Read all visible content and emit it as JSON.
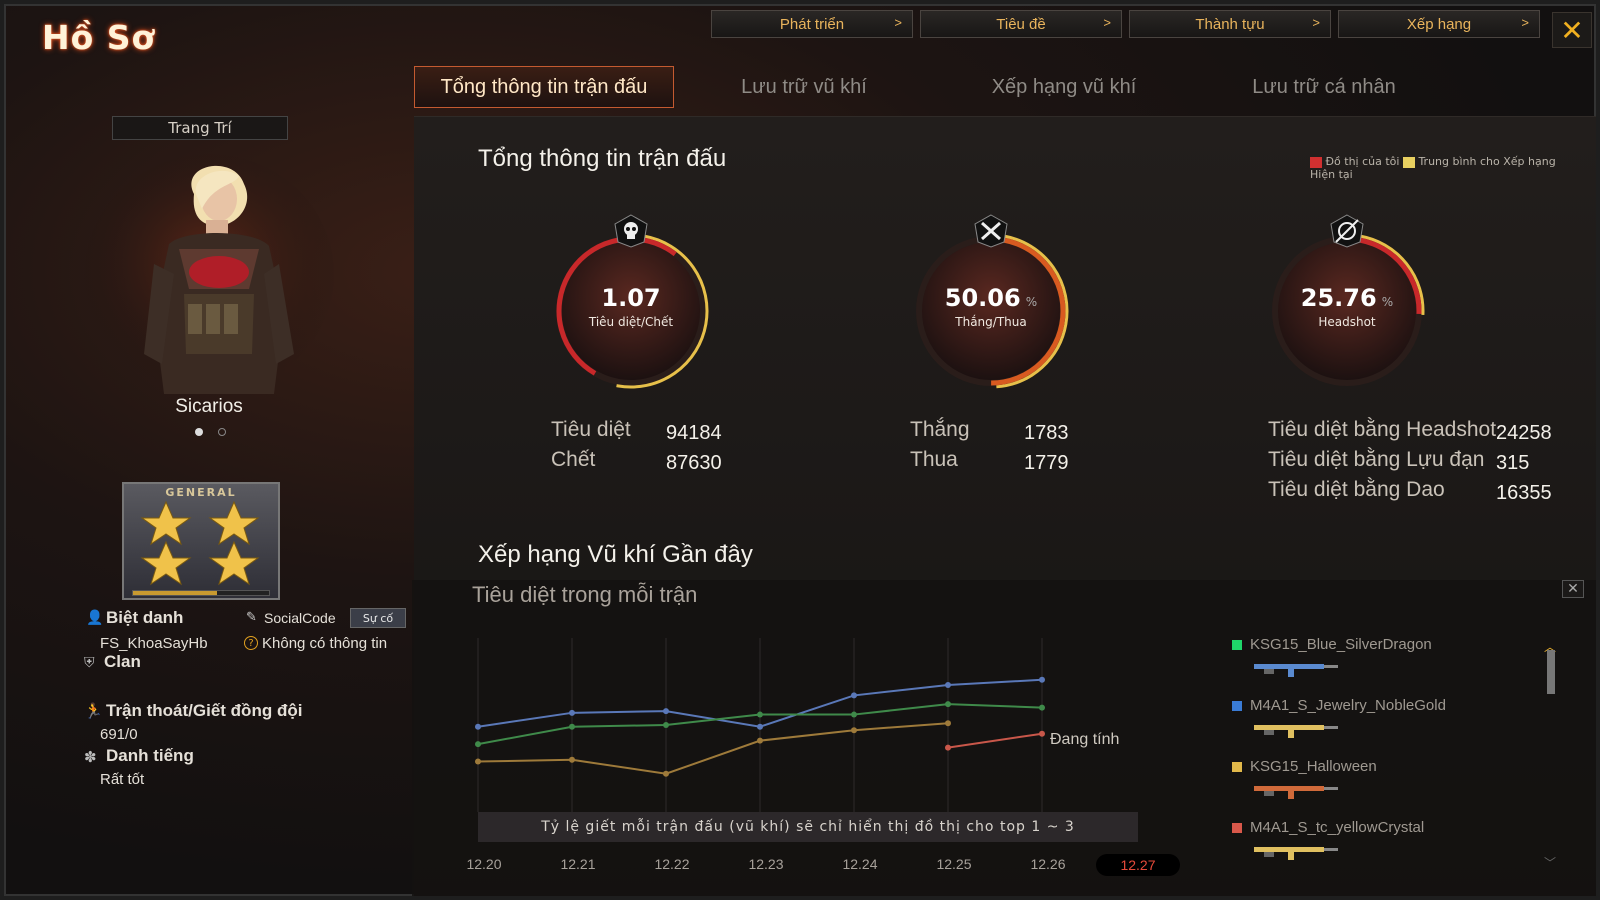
{
  "title": "Hồ Sơ",
  "top_nav": [
    {
      "label": "Phát triển",
      "chev": ">"
    },
    {
      "label": "Tiêu đề",
      "chev": ">"
    },
    {
      "label": "Thành tựu",
      "chev": ">"
    },
    {
      "label": "Xếp hạng",
      "chev": ">"
    }
  ],
  "close_icon": "✕",
  "tabs": [
    {
      "label": "Tổng thông tin trận đấu",
      "active": true
    },
    {
      "label": "Lưu trữ vũ khí",
      "active": false
    },
    {
      "label": "Xếp hạng vũ khí",
      "active": false
    },
    {
      "label": "Lưu trữ cá nhân",
      "active": false
    }
  ],
  "left": {
    "decor_button": "Trang Trí",
    "character_name": "Sicarios",
    "rank_label": "GENERAL",
    "nickname_label": "Biệt danh",
    "nickname_value": "FS_KhoaSayHb",
    "socialcode_label": "SocialCode",
    "socialcode_button": "Sự cố",
    "socialcode_value": "Không có thông tin",
    "clan_label": "Clan",
    "escape_label": "Trận thoát/Giết đồng đội",
    "escape_value": "691/0",
    "reputation_label": "Danh tiếng",
    "reputation_value": "Rất tốt"
  },
  "main": {
    "section_title": "Tổng thông tin trận đấu",
    "legend_mine": "Đồ thị của tôi",
    "legend_avg": "Trung bình cho Xếp hạng Hiện tại",
    "kd": {
      "value": "1.07",
      "unit": "",
      "label": "Tiêu diệt/Chết",
      "fraction": 0.52
    },
    "wl": {
      "value": "50.06",
      "unit": "%",
      "label": "Thắng/Thua",
      "fraction": 0.5
    },
    "hs": {
      "value": "25.76",
      "unit": "%",
      "label": "Headshot",
      "fraction": 0.26
    },
    "kd_rows": [
      {
        "label": "Tiêu diệt",
        "value": "94184"
      },
      {
        "label": "Chết",
        "value": "87630"
      }
    ],
    "wl_rows": [
      {
        "label": "Thắng",
        "value": "1783"
      },
      {
        "label": "Thua",
        "value": "1779"
      }
    ],
    "hs_rows": [
      {
        "label": "Tiêu diệt bằng Headshot",
        "value": "24258"
      },
      {
        "label": "Tiêu diệt bằng Lựu đạn",
        "value": "315"
      },
      {
        "label": "Tiêu diệt bằng Dao",
        "value": "16355"
      }
    ],
    "weapons_title": "Xếp hạng Vũ khí Gần đây",
    "chart_subtitle": "Tiêu diệt trong mỗi trận",
    "chart_note": "Tỷ lệ giết mỗi trận đấu (vũ khí) sẽ chỉ hiển thị đồ thị cho top 1 ~ 3",
    "computing": "Đang tính",
    "chart_close": "✕"
  },
  "chart_data": {
    "type": "line",
    "x": [
      "12.20",
      "12.21",
      "12.22",
      "12.23",
      "12.24",
      "12.25",
      "12.26",
      "12.27"
    ],
    "ylim": [
      0,
      10
    ],
    "series": [
      {
        "name": "KSG15_Blue_SilverDragon",
        "color": "#5a78b8",
        "values": [
          4.9,
          5.7,
          5.8,
          4.9,
          6.7,
          7.3,
          7.6,
          null
        ]
      },
      {
        "name": "M4A1_S_Jewelry_NobleGold",
        "color": "#3f8a4a",
        "values": [
          3.9,
          4.9,
          5.0,
          5.6,
          5.6,
          6.2,
          6.0,
          null
        ]
      },
      {
        "name": "KSG15_Halloween",
        "color": "#9e7a3a",
        "values": [
          2.9,
          3.0,
          2.2,
          4.1,
          4.7,
          5.1,
          null,
          null
        ]
      },
      {
        "name": "M4A1_S_tc_yellowCrystal",
        "color": "#c9574a",
        "values": [
          null,
          null,
          null,
          null,
          null,
          3.7,
          4.5,
          null
        ]
      }
    ],
    "legend": [
      {
        "name": "KSG15_Blue_SilverDragon",
        "color": "#1fd66a"
      },
      {
        "name": "M4A1_S_Jewelry_NobleGold",
        "color": "#3a7bd5"
      },
      {
        "name": "KSG15_Halloween",
        "color": "#e1b84a"
      },
      {
        "name": "M4A1_S_tc_yellowCrystal",
        "color": "#d9584a"
      }
    ],
    "active_x": "12.27"
  }
}
